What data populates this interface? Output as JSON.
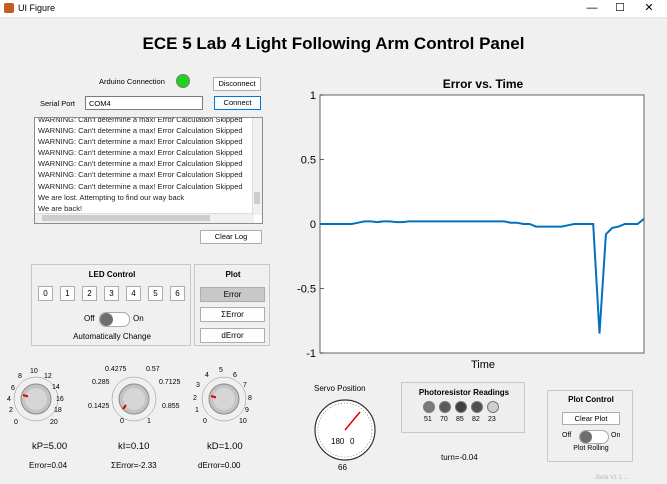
{
  "window": {
    "title": "UI Figure",
    "controls": [
      "—",
      "☐",
      "✕"
    ]
  },
  "header": {
    "title": "ECE 5 Lab 4 Light Following Arm Control Panel"
  },
  "connection": {
    "arduino_label": "Arduino Connection",
    "status_color": "#1fd41f",
    "disconnect_label": "Disconnect",
    "serial_port_label": "Serial Port",
    "serial_port_value": "COM4",
    "connect_label": "Connect"
  },
  "log": {
    "lines": [
      "WARNING: Can't determine a max! Error Calculation Skipped",
      "WARNING: Can't determine a max! Error Calculation Skipped",
      "WARNING: Can't determine a max! Error Calculation Skipped",
      "WARNING: Can't determine a max! Error Calculation Skipped",
      "WARNING: Can't determine a max! Error Calculation Skipped",
      "WARNING: Can't determine a max! Error Calculation Skipped",
      "WARNING: Can't determine a max! Error Calculation Skipped",
      "We are lost. Attempting to find our way back",
      "We are back!"
    ],
    "clear_label": "Clear Log"
  },
  "led_control": {
    "title": "LED Control",
    "buttons": [
      "0",
      "1",
      "2",
      "3",
      "4",
      "5",
      "6"
    ],
    "toggle_off": "Off",
    "toggle_on": "On",
    "auto_label": "Automatically Change"
  },
  "plot_select": {
    "title": "Plot",
    "buttons": [
      "Error",
      "ΣError",
      "dError"
    ]
  },
  "chart_data": {
    "type": "line",
    "title": "Error vs. Time",
    "xlabel": "Time",
    "ylabel": "",
    "ylim": [
      -1,
      1
    ],
    "yticks": [
      "1",
      "0.5",
      "0",
      "-0.5",
      "-1"
    ],
    "color": "#0072bd",
    "series": [
      {
        "values": [
          0,
          0,
          0,
          0,
          0,
          0,
          0.01,
          0.02,
          0.02,
          0.015,
          0.02,
          0.02,
          0.015,
          0.015,
          0.02,
          0.02,
          0.02,
          0.02,
          0.02,
          0.02,
          0.02,
          0.02,
          0.02,
          0.02,
          0.02,
          0.02,
          0.02,
          0.02,
          0.02,
          0.02,
          0.01,
          0.01,
          0,
          0,
          -0.02,
          -0.02,
          -0.02,
          -0.02,
          -0.02,
          -0.01,
          0,
          0,
          0,
          0,
          -0.85,
          -0.08,
          -0.03,
          -0.02,
          0,
          0,
          0,
          0.04
        ]
      }
    ]
  },
  "knobs": [
    {
      "name": "kP",
      "ticks": [
        "0",
        "2",
        "4",
        "6",
        "8",
        "10",
        "12",
        "14",
        "16",
        "18",
        "20"
      ],
      "value_label": "kP=5.00",
      "err_label": "Error=0.04"
    },
    {
      "name": "kI",
      "ticks": [
        "0",
        "0.1425",
        "0.285",
        "0.4275",
        "0.57",
        "0.7125",
        "0.855",
        "1"
      ],
      "value_label": "kI=0.10",
      "err_label": "ΣError=-2.33"
    },
    {
      "name": "kD",
      "ticks": [
        "0",
        "1",
        "2",
        "3",
        "4",
        "5",
        "6",
        "7",
        "8",
        "9",
        "10"
      ],
      "value_label": "kD=1.00",
      "err_label": "dError=0.00"
    }
  ],
  "servo": {
    "title": "Servo Position",
    "left_mark": "180",
    "right_mark": "0",
    "value": "66"
  },
  "photoresistor": {
    "title": "Photoresistor Readings",
    "values": [
      "51",
      "70",
      "85",
      "82",
      "23"
    ],
    "colors": [
      "#7a7a7a",
      "#5a5a5a",
      "#3e3e3e",
      "#505050",
      "#cfcfcf"
    ]
  },
  "turn_label": "turn=-0.04",
  "plot_control": {
    "title": "Plot Control",
    "clear_label": "Clear Plot",
    "toggle_off": "Off",
    "toggle_on": "On",
    "rolling_label": "Plot Rolling"
  },
  "footer": {
    "watermark": "Beta V1.1 ..."
  }
}
